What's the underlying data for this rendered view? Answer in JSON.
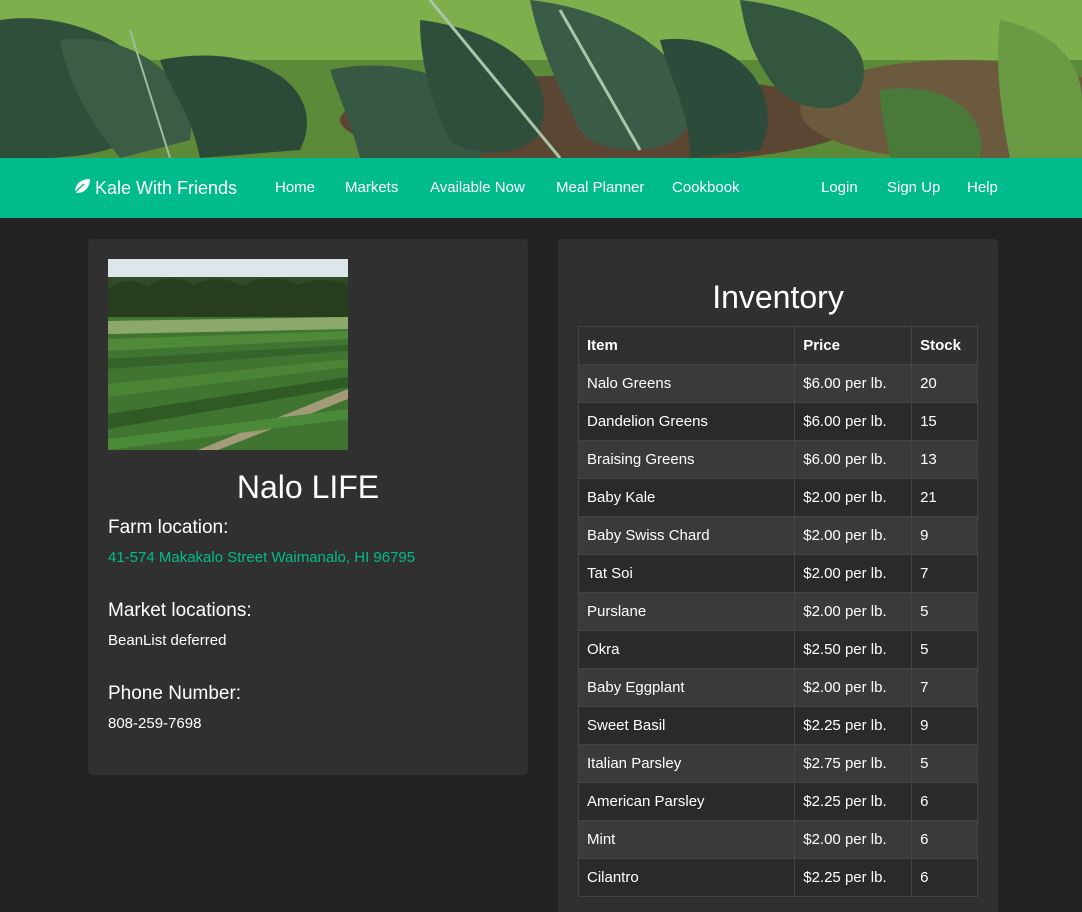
{
  "navbar": {
    "brand": "Kale With Friends",
    "brand_icon": "leaf-icon",
    "links": [
      "Home",
      "Markets",
      "Available Now",
      "Meal Planner",
      "Cookbook"
    ],
    "right_links": [
      "Login",
      "Sign Up",
      "Help"
    ]
  },
  "farm": {
    "name": "Nalo LIFE",
    "location_heading": "Farm location:",
    "address": "41-574 Makakalo Street Waimanalo, HI 96795",
    "markets_heading": "Market locations:",
    "markets_value": "BeanList deferred",
    "phone_heading": "Phone Number:",
    "phone": "808-259-7698"
  },
  "inventory": {
    "title": "Inventory",
    "columns": [
      "Item",
      "Price",
      "Stock"
    ],
    "rows": [
      {
        "item": "Nalo Greens",
        "price": "$6.00 per lb.",
        "stock": "20"
      },
      {
        "item": "Dandelion Greens",
        "price": "$6.00 per lb.",
        "stock": "15"
      },
      {
        "item": "Braising Greens",
        "price": "$6.00 per lb.",
        "stock": "13"
      },
      {
        "item": "Baby Kale",
        "price": "$2.00 per lb.",
        "stock": "21"
      },
      {
        "item": "Baby Swiss Chard",
        "price": "$2.00 per lb.",
        "stock": "9"
      },
      {
        "item": "Tat Soi",
        "price": "$2.00 per lb.",
        "stock": "7"
      },
      {
        "item": "Purslane",
        "price": "$2.00 per lb.",
        "stock": "5"
      },
      {
        "item": "Okra",
        "price": "$2.50 per lb.",
        "stock": "5"
      },
      {
        "item": "Baby Eggplant",
        "price": "$2.00 per lb.",
        "stock": "7"
      },
      {
        "item": "Sweet Basil",
        "price": "$2.25 per lb.",
        "stock": "9"
      },
      {
        "item": "Italian Parsley",
        "price": "$2.75 per lb.",
        "stock": "5"
      },
      {
        "item": "American Parsley",
        "price": "$2.25 per lb.",
        "stock": "6"
      },
      {
        "item": "Mint",
        "price": "$2.00 per lb.",
        "stock": "6"
      },
      {
        "item": "Cilantro",
        "price": "$2.25 per lb.",
        "stock": "6"
      }
    ]
  },
  "colors": {
    "accent": "#00bc8c",
    "background": "#222222",
    "card": "#303030"
  }
}
